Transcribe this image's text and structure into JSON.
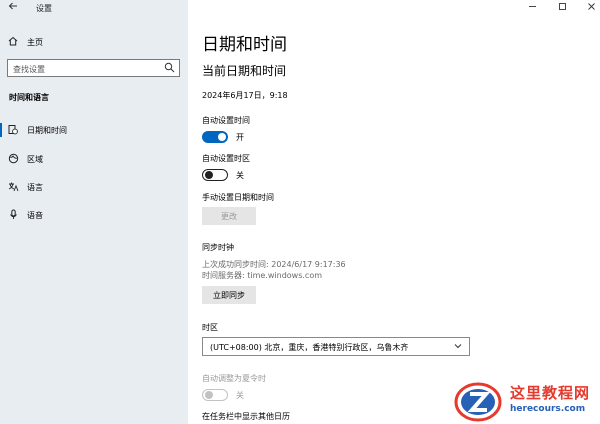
{
  "window": {
    "title": "设置",
    "back_icon": "back-arrow-icon",
    "controls": [
      "minimize-icon",
      "maximize-icon",
      "close-icon"
    ]
  },
  "sidebar": {
    "home_label": "主页",
    "search_placeholder": "查找设置",
    "section_title": "时间和语言",
    "items": [
      {
        "label": "日期和时间",
        "icon": "calendar-clock-icon",
        "active": true
      },
      {
        "label": "区域",
        "icon": "globe-icon",
        "active": false
      },
      {
        "label": "语言",
        "icon": "language-icon",
        "active": false
      },
      {
        "label": "语音",
        "icon": "microphone-icon",
        "active": false
      }
    ]
  },
  "main": {
    "page_title": "日期和时间",
    "section_title": "当前日期和时间",
    "current_datetime": "2024年6月17日，9:18",
    "auto_time": {
      "label": "自动设置时间",
      "state_label": "开",
      "on": true
    },
    "auto_timezone": {
      "label": "自动设置时区",
      "state_label": "关",
      "on": false
    },
    "manual_set": {
      "label": "手动设置日期和时间",
      "button": "更改"
    },
    "sync": {
      "title": "同步时钟",
      "last_sync": "上次成功同步时间: 2024/6/17 9:17:36",
      "server": "时间服务器: time.windows.com",
      "button": "立即同步"
    },
    "timezone": {
      "label": "时区",
      "value": "(UTC+08:00) 北京，重庆，香港特别行政区，乌鲁木齐"
    },
    "dst": {
      "label": "自动调整为夏令时",
      "state_label": "关",
      "disabled": true
    },
    "extra_calendar_label": "在任务栏中显示其他日历"
  },
  "watermark": {
    "title": "这里教程网",
    "url": "herecours.com",
    "accent": "#e53a2e",
    "secondary": "#2760b7"
  },
  "colors": {
    "accent": "#0067c0",
    "sidebar_bg": "#e8edf2"
  }
}
